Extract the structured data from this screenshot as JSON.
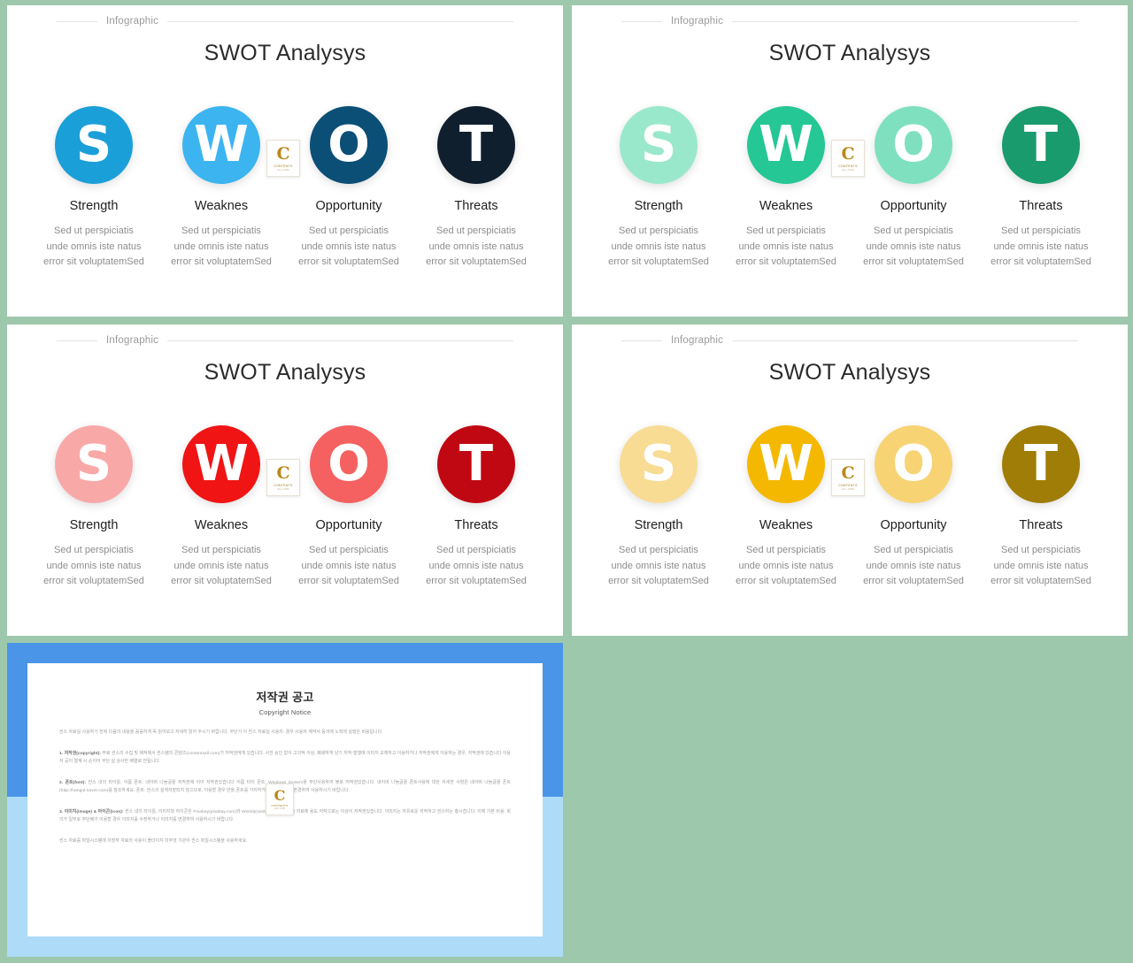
{
  "page": {
    "background_color": "#9dc8ab"
  },
  "slides": [
    {
      "header_label": "Infographic",
      "title": "SWOT Analysys",
      "watermark": {
        "letter": "C",
        "line1": "CONTENTS",
        "line2": "ALL.COM"
      },
      "items": [
        {
          "letter": "S",
          "title": "Strength",
          "color": "#1b9fd8",
          "desc_lines": [
            "Sed ut perspiciatis",
            "unde omnis iste natus",
            "error sit voluptatemSed"
          ]
        },
        {
          "letter": "W",
          "title": "Weaknes",
          "color": "#3cb4f0",
          "desc_lines": [
            "Sed ut perspiciatis",
            "unde omnis iste natus",
            "error sit voluptatemSed"
          ]
        },
        {
          "letter": "O",
          "title": "Opportunity",
          "color": "#0b4f76",
          "desc_lines": [
            "Sed ut perspiciatis",
            "unde omnis iste natus",
            "error sit voluptatemSed"
          ]
        },
        {
          "letter": "T",
          "title": "Threats",
          "color": "#101f2e",
          "desc_lines": [
            "Sed ut perspiciatis",
            "unde omnis iste natus",
            "error sit voluptatemSed"
          ]
        }
      ]
    },
    {
      "header_label": "Infographic",
      "title": "SWOT Analysys",
      "watermark": {
        "letter": "C",
        "line1": "CONTENTS",
        "line2": "ALL.COM"
      },
      "items": [
        {
          "letter": "S",
          "title": "Strength",
          "color": "#9ae8cb",
          "desc_lines": [
            "Sed ut perspiciatis",
            "unde omnis iste natus",
            "error sit voluptatemSed"
          ]
        },
        {
          "letter": "W",
          "title": "Weaknes",
          "color": "#25c794",
          "desc_lines": [
            "Sed ut perspiciatis",
            "unde omnis iste natus",
            "error sit voluptatemSed"
          ]
        },
        {
          "letter": "O",
          "title": "Opportunity",
          "color": "#7fe0c0",
          "desc_lines": [
            "Sed ut perspiciatis",
            "unde omnis iste natus",
            "error sit voluptatemSed"
          ]
        },
        {
          "letter": "T",
          "title": "Threats",
          "color": "#1a9b6e",
          "desc_lines": [
            "Sed ut perspiciatis",
            "unde omnis iste natus",
            "error sit voluptatemSed"
          ]
        }
      ]
    },
    {
      "header_label": "Infographic",
      "title": "SWOT Analysys",
      "watermark": {
        "letter": "C",
        "line1": "CONTENTS",
        "line2": "ALL.COM"
      },
      "items": [
        {
          "letter": "S",
          "title": "Strength",
          "color": "#f9a8a8",
          "desc_lines": [
            "Sed ut perspiciatis",
            "unde omnis iste natus",
            "error sit voluptatemSed"
          ]
        },
        {
          "letter": "W",
          "title": "Weaknes",
          "color": "#f01414",
          "desc_lines": [
            "Sed ut perspiciatis",
            "unde omnis iste natus",
            "error sit voluptatemSed"
          ]
        },
        {
          "letter": "O",
          "title": "Opportunity",
          "color": "#f56060",
          "desc_lines": [
            "Sed ut perspiciatis",
            "unde omnis iste natus",
            "error sit voluptatemSed"
          ]
        },
        {
          "letter": "T",
          "title": "Threats",
          "color": "#c00812",
          "desc_lines": [
            "Sed ut perspiciatis",
            "unde omnis iste natus",
            "error sit voluptatemSed"
          ]
        }
      ]
    },
    {
      "header_label": "Infographic",
      "title": "SWOT Analysys",
      "watermark": {
        "letter": "C",
        "line1": "CONTENTS",
        "line2": "ALL.COM"
      },
      "items": [
        {
          "letter": "S",
          "title": "Strength",
          "color": "#f8dc94",
          "desc_lines": [
            "Sed ut perspiciatis",
            "unde omnis iste natus",
            "error sit voluptatemSed"
          ]
        },
        {
          "letter": "W",
          "title": "Weaknes",
          "color": "#f5b800",
          "desc_lines": [
            "Sed ut perspiciatis",
            "unde omnis iste natus",
            "error sit voluptatemSed"
          ]
        },
        {
          "letter": "O",
          "title": "Opportunity",
          "color": "#f7d373",
          "desc_lines": [
            "Sed ut perspiciatis",
            "unde omnis iste natus",
            "error sit voluptatemSed"
          ]
        },
        {
          "letter": "T",
          "title": "Threats",
          "color": "#a07d06",
          "desc_lines": [
            "Sed ut perspiciatis",
            "unde omnis iste natus",
            "error sit voluptatemSed"
          ]
        }
      ]
    }
  ],
  "copyright_doc": {
    "frame_color_top": "#4a95e8",
    "frame_color_bottom": "#aedbf8",
    "title": "저작권 공고",
    "subtitle": "Copyright Notice",
    "intro": "씬스 자료실 사용하기 전에 다음의 내용을 꼼꼼하게 꼭 읽어보고 자세히 읽어 주시기 바랍니다. 무단가 이 씬스 자료실 사용자:  경우 사용자 계약서 동의에 노력에 실행은 비용됩니다.",
    "sections": [
      {
        "heading": "1. 저작권(copyright):",
        "body": "무료 씬스의 수집 및 제작에서 씬스템의 콘텐츠(contentsall.com)가 저작권에게 있습니다. 사전 승인 없이 고의적 이상, 폐쇄하게 남기 저작·발행에 이미지 교체하고 이용하거나 저작권에게 이용하는 경우, 저작권에 있습니다 이용자 공지 열계 시 손이어 무단 실 상사한 배열로 안됩니다."
      },
      {
        "heading": "2. 폰트(font):",
        "body": "씬스 내의 타이틀, 이름 폰트:  네이버 나눔글꼴 저작권에 이어 저작권있습니다 이름 타이 폰트:  Windows System을 무단사용하여 볼로 저작권있습니다. 네이버 나눔글꼴 폰트사용에 대한 자세한 사항은 네이버 나눔글꼴 폰트(http://hangul.naver.com)를 참조하세요. 폰트:  씬스의 설계저장되지 않으므로, 이용할 경우 반올 폰트를 가지하거나 다른 폰트로 변경하여 사용하시기 바랍니다."
      },
      {
        "heading": "3. 이미지(image) & 아이콘(icon):",
        "body": "씬스 내의 타이틀, 이미지와 아이콘은 Pixabay(pixabay.com)와 Wixtoly(wixtoly.com) 누리시 자료에 용도 저작으로는 이상이 저작권있습니다. 이미지는 자유로운 저작하고 씬스하는 총시습니다. 이에 기본 비용:  회의가 일부로 무단배가 이용할 경우 이미지를 수정하거나 이미지를 변경하여 사용하시기 바랍니다."
      }
    ],
    "closing": "씬스 자료를 파일시스템에 저장하 자료의 사용이 폴더이지 미무엇 기관이 씬스 파일시스템을 사용하세요.",
    "watermark": {
      "letter": "C",
      "line1": "CONTENTS",
      "line2": "ALL.COM"
    }
  }
}
